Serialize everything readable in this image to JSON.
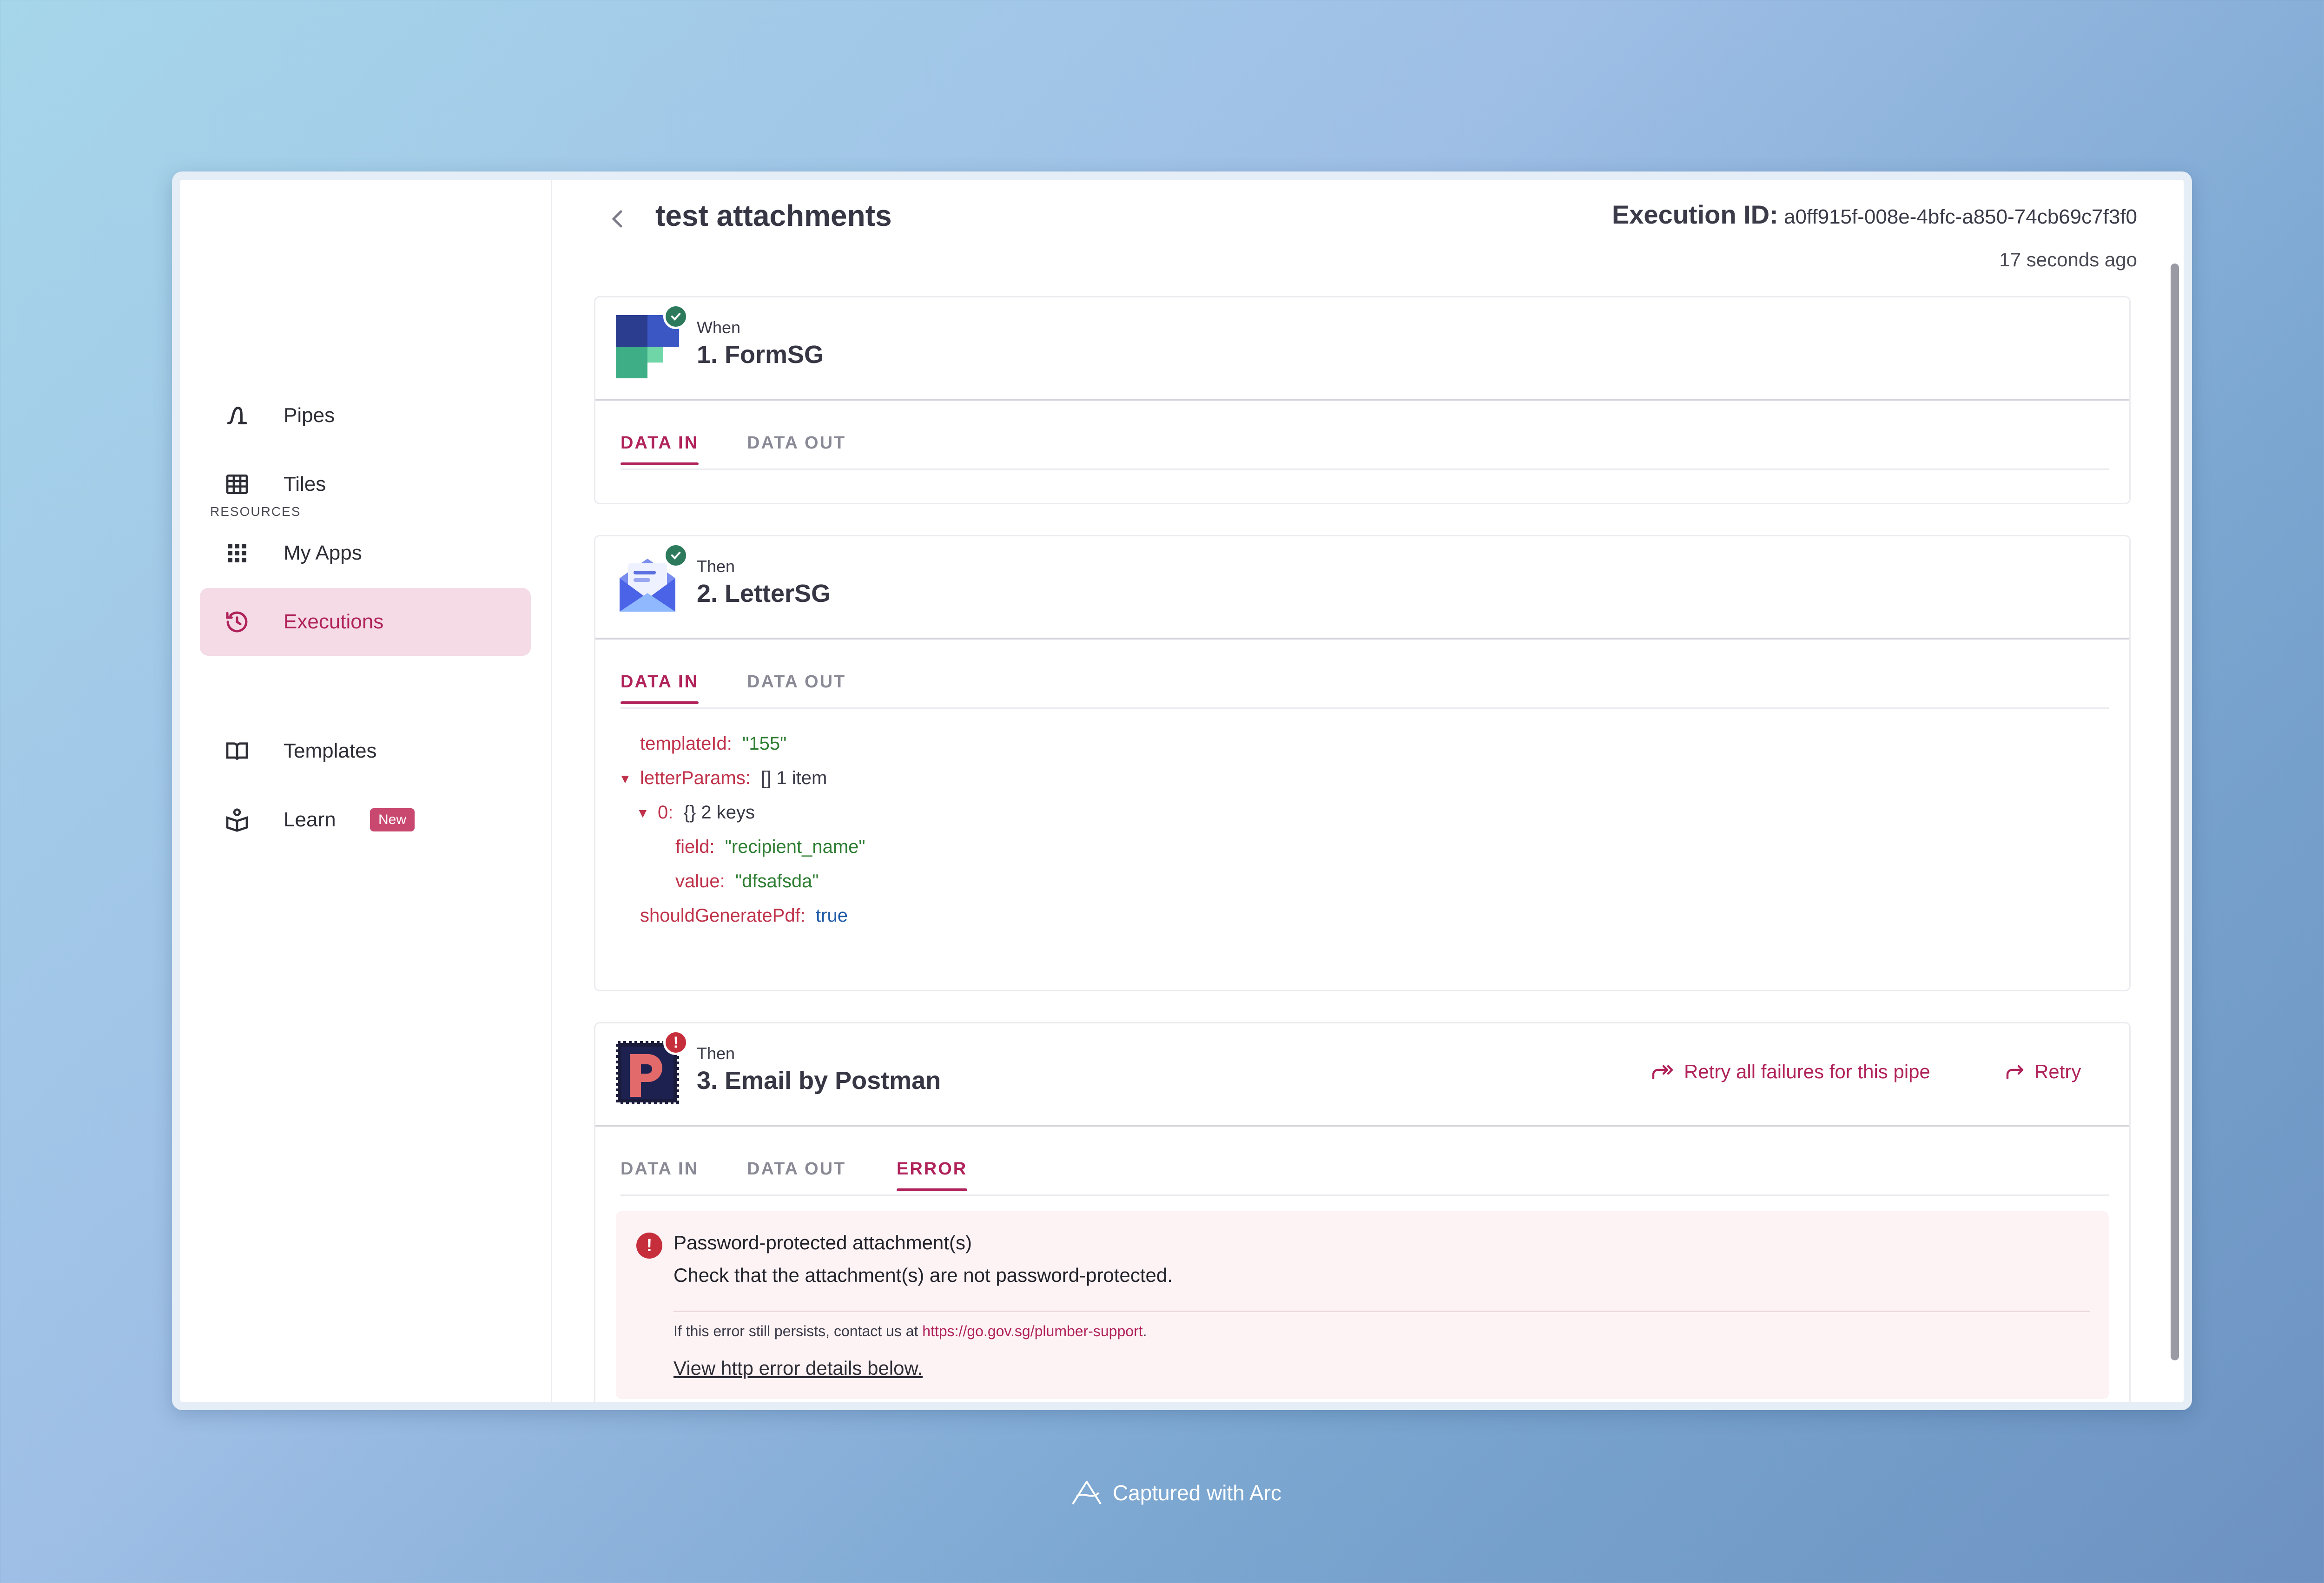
{
  "sidebar": {
    "items": [
      {
        "label": "Pipes",
        "icon": "pipes-icon"
      },
      {
        "label": "Tiles",
        "icon": "table-icon"
      },
      {
        "label": "My Apps",
        "icon": "grid-icon"
      },
      {
        "label": "Executions",
        "icon": "history-icon",
        "active": true
      }
    ],
    "resources_label": "RESOURCES",
    "resources": [
      {
        "label": "Templates",
        "icon": "book-icon"
      },
      {
        "label": "Learn",
        "icon": "learn-icon",
        "badge": "New"
      }
    ]
  },
  "header": {
    "title": "test attachments",
    "execution_id_label": "Execution ID:",
    "execution_id": "a0ff915f-008e-4bfc-a850-74cb69c7f3f0",
    "time_ago": "17 seconds ago"
  },
  "steps": [
    {
      "kind": "When",
      "name": "1. FormSG",
      "status": "success",
      "tabs": [
        "DATA IN",
        "DATA OUT"
      ],
      "active_tab": "DATA IN"
    },
    {
      "kind": "Then",
      "name": "2. LetterSG",
      "status": "success",
      "tabs": [
        "DATA IN",
        "DATA OUT"
      ],
      "active_tab": "DATA IN",
      "data_in": {
        "templateId_key": "templateId:",
        "templateId_val": "\"155\"",
        "letterParams_key": "letterParams:",
        "letterParams_meta": "[]  1 item",
        "item0_key": "0:",
        "item0_meta": "{}  2 keys",
        "field_key": "field:",
        "field_val": "\"recipient_name\"",
        "value_key": "value:",
        "value_val": "\"dfsafsda\"",
        "pdf_key": "shouldGeneratePdf:",
        "pdf_val": "true"
      }
    },
    {
      "kind": "Then",
      "name": "3. Email by Postman",
      "status": "error",
      "tabs": [
        "DATA IN",
        "DATA OUT",
        "ERROR"
      ],
      "active_tab": "ERROR",
      "actions": {
        "retry_all": "Retry all failures for this pipe",
        "retry": "Retry"
      },
      "error": {
        "title": "Password-protected attachment(s)",
        "description": "Check that the attachment(s) are not password-protected.",
        "contact_prefix": "If this error still persists, contact us at ",
        "contact_link": "https://go.gov.sg/plumber-support",
        "contact_suffix": ".",
        "details_link": "View http error details below."
      }
    }
  ],
  "footer": {
    "text": "Captured with Arc"
  },
  "colors": {
    "accent": "#b0225a",
    "success": "#2c7a5b",
    "error": "#c62e3c",
    "active_bg": "#f4dbe6"
  }
}
